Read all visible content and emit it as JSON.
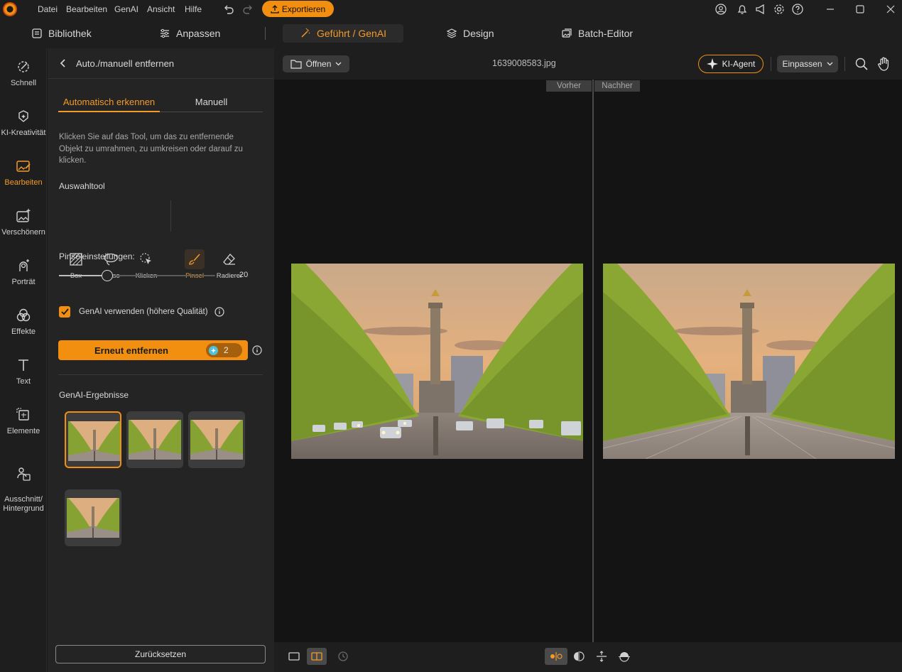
{
  "menu": {
    "items": [
      "Datei",
      "Bearbeiten",
      "GenAI",
      "Ansicht",
      "Hilfe"
    ],
    "export_label": "Exportieren"
  },
  "modes": {
    "bibliothek": "Bibliothek",
    "anpassen": "Anpassen",
    "genai": "Geführt / GenAI",
    "design": "Design",
    "batch": "Batch-Editor"
  },
  "rail": {
    "items": [
      "Schnell",
      "KI-Kreativität",
      "Bearbeiten",
      "Verschönern",
      "Porträt",
      "Effekte",
      "Text",
      "Elemente",
      "Ausschnitt/\nHintergrund"
    ],
    "active": "Bearbeiten"
  },
  "panel": {
    "title": "Auto./manuell entfernen",
    "tabs": [
      "Automatisch erkennen",
      "Manuell"
    ],
    "description": "Klicken Sie auf das Tool, um das zu entfernende Objekt zu umrahmen, zu umkreisen oder darauf zu klicken.",
    "tool_heading": "Auswahltool",
    "tools": [
      "Box",
      "Lasso",
      "Klicken",
      "Pinsel",
      "Radierer"
    ],
    "active_tool": "Pinsel",
    "brush_label": "Pinseleinstellungen:",
    "brush_value": "20",
    "brush_fraction": 0.31,
    "genai_checkbox": "GenAI verwenden (höhere Qualität)",
    "genai_checked": true,
    "action_button": "Erneut entfernen",
    "credits": "2",
    "results_heading": "GenAI-Ergebnisse",
    "reset_button": "Zurücksetzen"
  },
  "toolbar": {
    "open_label": "Öffnen",
    "filename": "1639008583.jpg",
    "agent_label": "KI-Agent",
    "fit_label": "Einpassen"
  },
  "compare": {
    "before": "Vorher",
    "after": "Nachher"
  },
  "colors": {
    "accent": "#f39a2a",
    "button": "#f28f11"
  }
}
